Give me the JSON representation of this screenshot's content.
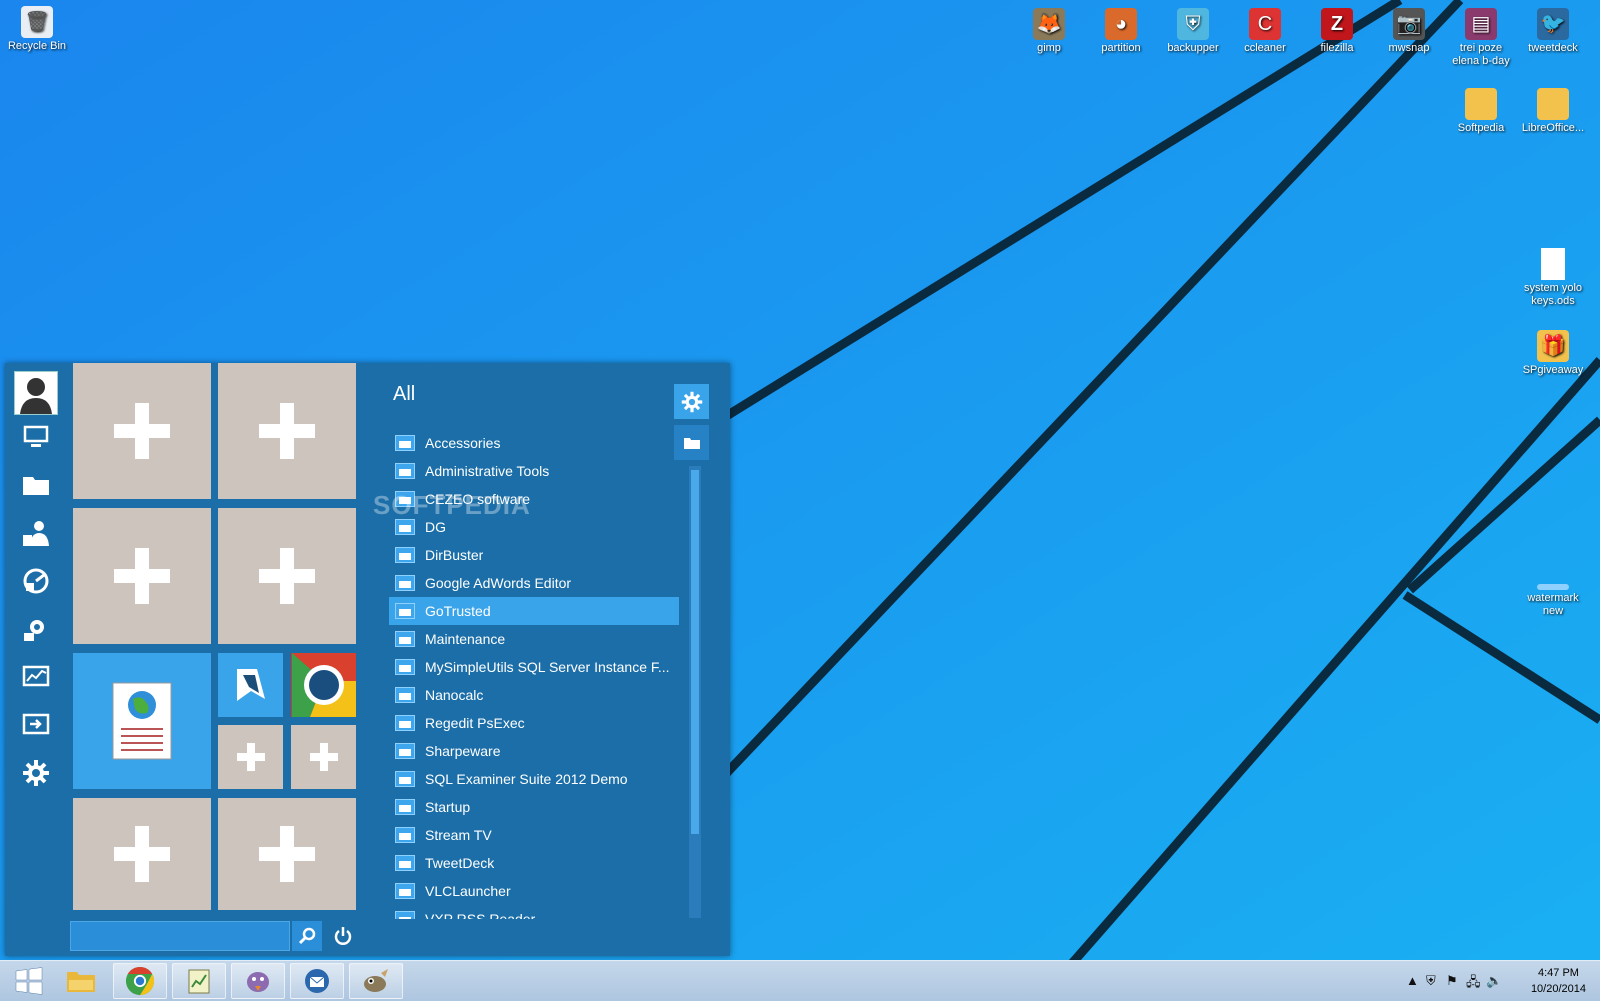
{
  "desktop": {
    "recycle_bin": "Recycle Bin",
    "icons_top": [
      "gimp",
      "partition",
      "backupper",
      "ccleaner",
      "filezilla",
      "mwsnap",
      "trei poze elena b-day",
      "tweetdeck"
    ],
    "softpedia": "Softpedia",
    "libreoffice": "LibreOffice...",
    "system_keys": "system yolo keys.ods",
    "spgiveaway": "SPgiveaway",
    "watermark_new": "watermark new"
  },
  "start_menu": {
    "all_label": "All",
    "search": {
      "value": "",
      "placeholder": ""
    },
    "programs": [
      "Accessories",
      "Administrative Tools",
      "CEZEO software",
      "DG",
      "DirBuster",
      "Google AdWords Editor",
      "GoTrusted",
      "Maintenance",
      "MySimpleUtils SQL Server Instance F...",
      "Nanocalc",
      "Regedit PsExec",
      "Sharpeware",
      "SQL Examiner Suite 2012 Demo",
      "Startup",
      "Stream TV",
      "TweetDeck",
      "VLCLauncher",
      "VXP RSS Reader"
    ],
    "selected_program": "GoTrusted",
    "watermark": "SOFTPEDIA"
  },
  "taskbar": {
    "clock_time": "4:47 PM",
    "clock_date": "10/20/2014"
  }
}
